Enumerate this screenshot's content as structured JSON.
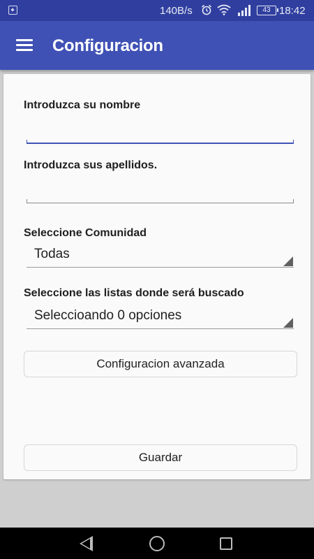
{
  "status_bar": {
    "speed": "140B/s",
    "battery": "43",
    "time": "18:42",
    "icons": [
      "image-notification-icon",
      "alarm-icon",
      "wifi-icon",
      "signal-icon",
      "battery-icon"
    ]
  },
  "toolbar": {
    "title": "Configuracion",
    "menu_icon": "hamburger-menu-icon",
    "color": "#3f51b5",
    "status_color": "#303f9f"
  },
  "form": {
    "name_label": "Introduzca su nombre",
    "name_value": "",
    "surname_label": "Introduzca sus apellidos.",
    "surname_value": "",
    "community_label": "Seleccione Comunidad",
    "community_value": "Todas",
    "lists_label": "Seleccione las listas donde será buscado",
    "lists_value": "Seleccioando 0 opciones",
    "advanced_button": "Configuracion avanzada",
    "save_button": "Guardar"
  },
  "navbar": {
    "icons": [
      "back-icon",
      "home-icon",
      "recents-icon"
    ]
  }
}
